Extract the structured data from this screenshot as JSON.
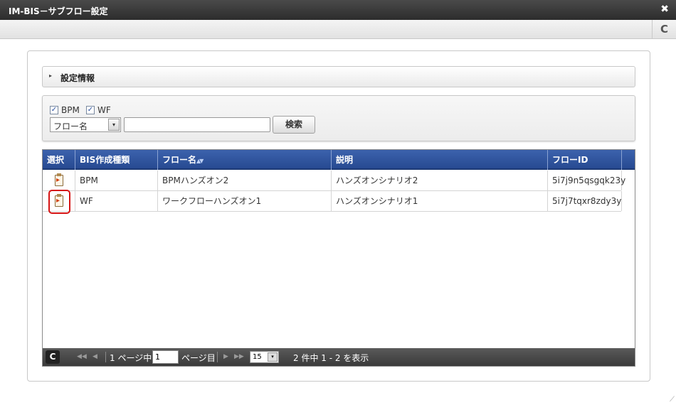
{
  "window": {
    "title": "IM-BIS－サブフロー設定",
    "close_glyph": "✖",
    "refresh_glyph": "C"
  },
  "settings": {
    "arrow_glyph": "▸",
    "label": "設定情報"
  },
  "search": {
    "checkboxes": [
      {
        "label": "BPM",
        "checked": true
      },
      {
        "label": "WF",
        "checked": true
      }
    ],
    "check_glyph": "✓",
    "field_select": {
      "value": "フロー名",
      "arrow": "▾"
    },
    "query_value": "",
    "button_label": "検索"
  },
  "grid": {
    "columns": [
      "選択",
      "BIS作成種類",
      "フロー名",
      "説明",
      "フローID"
    ],
    "sort_indicator": "▲▼",
    "rows": [
      {
        "type": "BPM",
        "flow_name": "BPMハンズオン2",
        "description": "ハンズオンシナリオ2",
        "flow_id": "5i7j9n5qsgqk23y"
      },
      {
        "type": "WF",
        "flow_name": "ワークフローハンズオン1",
        "description": "ハンズオンシナリオ1",
        "flow_id": "5i7j7tqxr8zdy3y"
      }
    ]
  },
  "pager": {
    "refresh_glyph": "C",
    "first_glyph": "◀◀",
    "prev_glyph": "◀",
    "next_glyph": "▶",
    "last_glyph": "▶▶",
    "total_pages_text": "1 ページ中",
    "current_page": "1",
    "page_suffix": "ページ目",
    "page_size": "15",
    "page_size_arrow": "▾",
    "summary": "2 件中 1 - 2 を表示"
  },
  "resize_glyph": "⟋"
}
